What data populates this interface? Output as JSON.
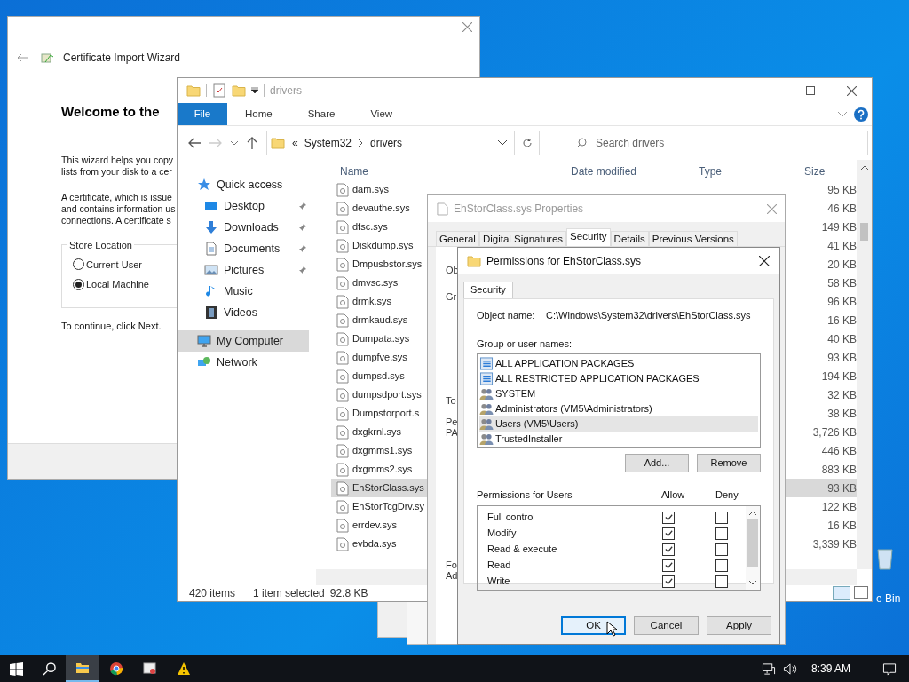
{
  "desktop": {
    "recycle_bin_label": "e Bin"
  },
  "wizard": {
    "title": "Certificate Import Wizard",
    "heading": "Welcome to the",
    "paragraphs": [
      [
        "This wizard helps you copy",
        "lists from your disk to a cer"
      ],
      [
        "A certificate, which is issue",
        "and contains information us",
        "connections. A certificate s"
      ]
    ],
    "store_location": {
      "legend": "Store Location",
      "options": [
        {
          "label": "Current User",
          "selected": false
        },
        {
          "label": "Local Machine",
          "selected": true
        }
      ]
    },
    "footer_text": "To continue, click Next."
  },
  "explorer": {
    "title": "drivers",
    "ribbon_tabs": [
      {
        "label": "File",
        "selected": true
      },
      {
        "label": "Home",
        "selected": false
      },
      {
        "label": "Share",
        "selected": false
      },
      {
        "label": "View",
        "selected": false
      }
    ],
    "address": {
      "prefix": "«",
      "crumbs": [
        "System32",
        "drivers"
      ]
    },
    "search": {
      "placeholder": "Search drivers"
    },
    "nav": [
      {
        "label": "Quick access",
        "kind": "star",
        "pinned": false,
        "selected": false,
        "children": [
          {
            "label": "Desktop",
            "kind": "desktop",
            "pinned": true,
            "selected": false
          },
          {
            "label": "Downloads",
            "kind": "download",
            "pinned": true,
            "selected": false
          },
          {
            "label": "Documents",
            "kind": "document",
            "pinned": true,
            "selected": false
          },
          {
            "label": "Pictures",
            "kind": "pictures",
            "pinned": true,
            "selected": false
          },
          {
            "label": "Music",
            "kind": "music",
            "pinned": false,
            "selected": false
          },
          {
            "label": "Videos",
            "kind": "video",
            "pinned": false,
            "selected": false
          }
        ]
      },
      {
        "label": "My Computer",
        "kind": "computer",
        "pinned": false,
        "selected": true
      },
      {
        "label": "Network",
        "kind": "network",
        "pinned": false,
        "selected": false
      }
    ],
    "columns": [
      "Name",
      "Date modified",
      "Type",
      "Size"
    ],
    "files": [
      {
        "name": "dam.sys",
        "size": "95 KB",
        "selected": false
      },
      {
        "name": "devauthe.sys",
        "size": "46 KB",
        "selected": false
      },
      {
        "name": "dfsc.sys",
        "size": "149 KB",
        "selected": false
      },
      {
        "name": "Diskdump.sys",
        "size": "41 KB",
        "selected": false
      },
      {
        "name": "Dmpusbstor.sys",
        "size": "20 KB",
        "selected": false
      },
      {
        "name": "dmvsc.sys",
        "size": "58 KB",
        "selected": false
      },
      {
        "name": "drmk.sys",
        "size": "96 KB",
        "selected": false
      },
      {
        "name": "drmkaud.sys",
        "size": "16 KB",
        "selected": false
      },
      {
        "name": "Dumpata.sys",
        "size": "40 KB",
        "selected": false
      },
      {
        "name": "dumpfve.sys",
        "size": "93 KB",
        "selected": false
      },
      {
        "name": "dumpsd.sys",
        "size": "194 KB",
        "selected": false
      },
      {
        "name": "dumpsdport.sys",
        "size": "32 KB",
        "selected": false
      },
      {
        "name": "Dumpstorport.s",
        "size": "38 KB",
        "selected": false
      },
      {
        "name": "dxgkrnl.sys",
        "size": "3,726 KB",
        "selected": false
      },
      {
        "name": "dxgmms1.sys",
        "size": "446 KB",
        "selected": false
      },
      {
        "name": "dxgmms2.sys",
        "size": "883 KB",
        "selected": false
      },
      {
        "name": "EhStorClass.sys",
        "size": "93 KB",
        "selected": true
      },
      {
        "name": "EhStorTcgDrv.sy",
        "size": "122 KB",
        "selected": false
      },
      {
        "name": "errdev.sys",
        "size": "16 KB",
        "selected": false
      },
      {
        "name": "evbda.sys",
        "size": "3,339 KB",
        "selected": false
      }
    ],
    "status": {
      "count": "420 items",
      "selection": "1 item selected",
      "selection_size": "92.8 KB"
    }
  },
  "properties": {
    "title": "EhStorClass.sys Properties",
    "tabs": [
      {
        "label": "General",
        "selected": false
      },
      {
        "label": "Digital Signatures",
        "selected": false
      },
      {
        "label": "Security",
        "selected": true
      },
      {
        "label": "Details",
        "selected": false
      },
      {
        "label": "Previous Versions",
        "selected": false
      }
    ],
    "peek_labels": [
      "Ob",
      "Gr",
      "To",
      "Pe",
      "PA",
      "Fo",
      "Ad"
    ]
  },
  "permissions": {
    "title": "Permissions for EhStorClass.sys",
    "tab": "Security",
    "object_label": "Object name:",
    "object_path": "C:\\Windows\\System32\\drivers\\EhStorClass.sys",
    "group_label": "Group or user names:",
    "principals": [
      {
        "name": "ALL APPLICATION PACKAGES",
        "kind": "package",
        "selected": false
      },
      {
        "name": "ALL RESTRICTED APPLICATION PACKAGES",
        "kind": "package",
        "selected": false
      },
      {
        "name": "SYSTEM",
        "kind": "group",
        "selected": false
      },
      {
        "name": "Administrators (VM5\\Administrators)",
        "kind": "group",
        "selected": false
      },
      {
        "name": "Users (VM5\\Users)",
        "kind": "group",
        "selected": true
      },
      {
        "name": "TrustedInstaller",
        "kind": "group",
        "selected": false
      }
    ],
    "principal_buttons": [
      "Add...",
      "Remove"
    ],
    "perm_label": "Permissions for Users",
    "allow_header": "Allow",
    "deny_header": "Deny",
    "rows": [
      {
        "name": "Full control",
        "allow": true,
        "deny": false
      },
      {
        "name": "Modify",
        "allow": true,
        "deny": false
      },
      {
        "name": "Read & execute",
        "allow": true,
        "deny": false
      },
      {
        "name": "Read",
        "allow": true,
        "deny": false
      },
      {
        "name": "Write",
        "allow": true,
        "deny": false
      }
    ],
    "buttons": [
      {
        "label": "OK",
        "focused": true
      },
      {
        "label": "Cancel",
        "focused": false
      },
      {
        "label": "Apply",
        "focused": false
      }
    ]
  },
  "taskbar": {
    "apps": [
      {
        "kind": "explorer",
        "active": true
      },
      {
        "kind": "chrome",
        "active": false
      },
      {
        "kind": "cert",
        "active": false
      },
      {
        "kind": "warning",
        "active": false
      }
    ],
    "time": "8:39 AM"
  }
}
